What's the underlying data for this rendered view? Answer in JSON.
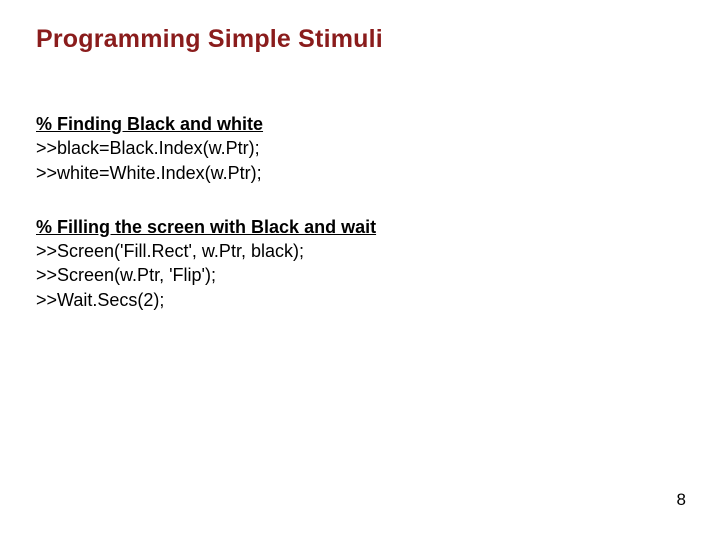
{
  "title": "Programming Simple Stimuli",
  "section1": {
    "heading": "% Finding Black and white",
    "lines": [
      ">>black=Black.Index(w.Ptr);",
      ">>white=White.Index(w.Ptr);"
    ]
  },
  "section2": {
    "heading": "% Filling the screen with Black and wait",
    "lines": [
      ">>Screen('Fill.Rect', w.Ptr, black);",
      ">>Screen(w.Ptr, 'Flip');",
      ">>Wait.Secs(2);"
    ]
  },
  "pageNumber": "8"
}
